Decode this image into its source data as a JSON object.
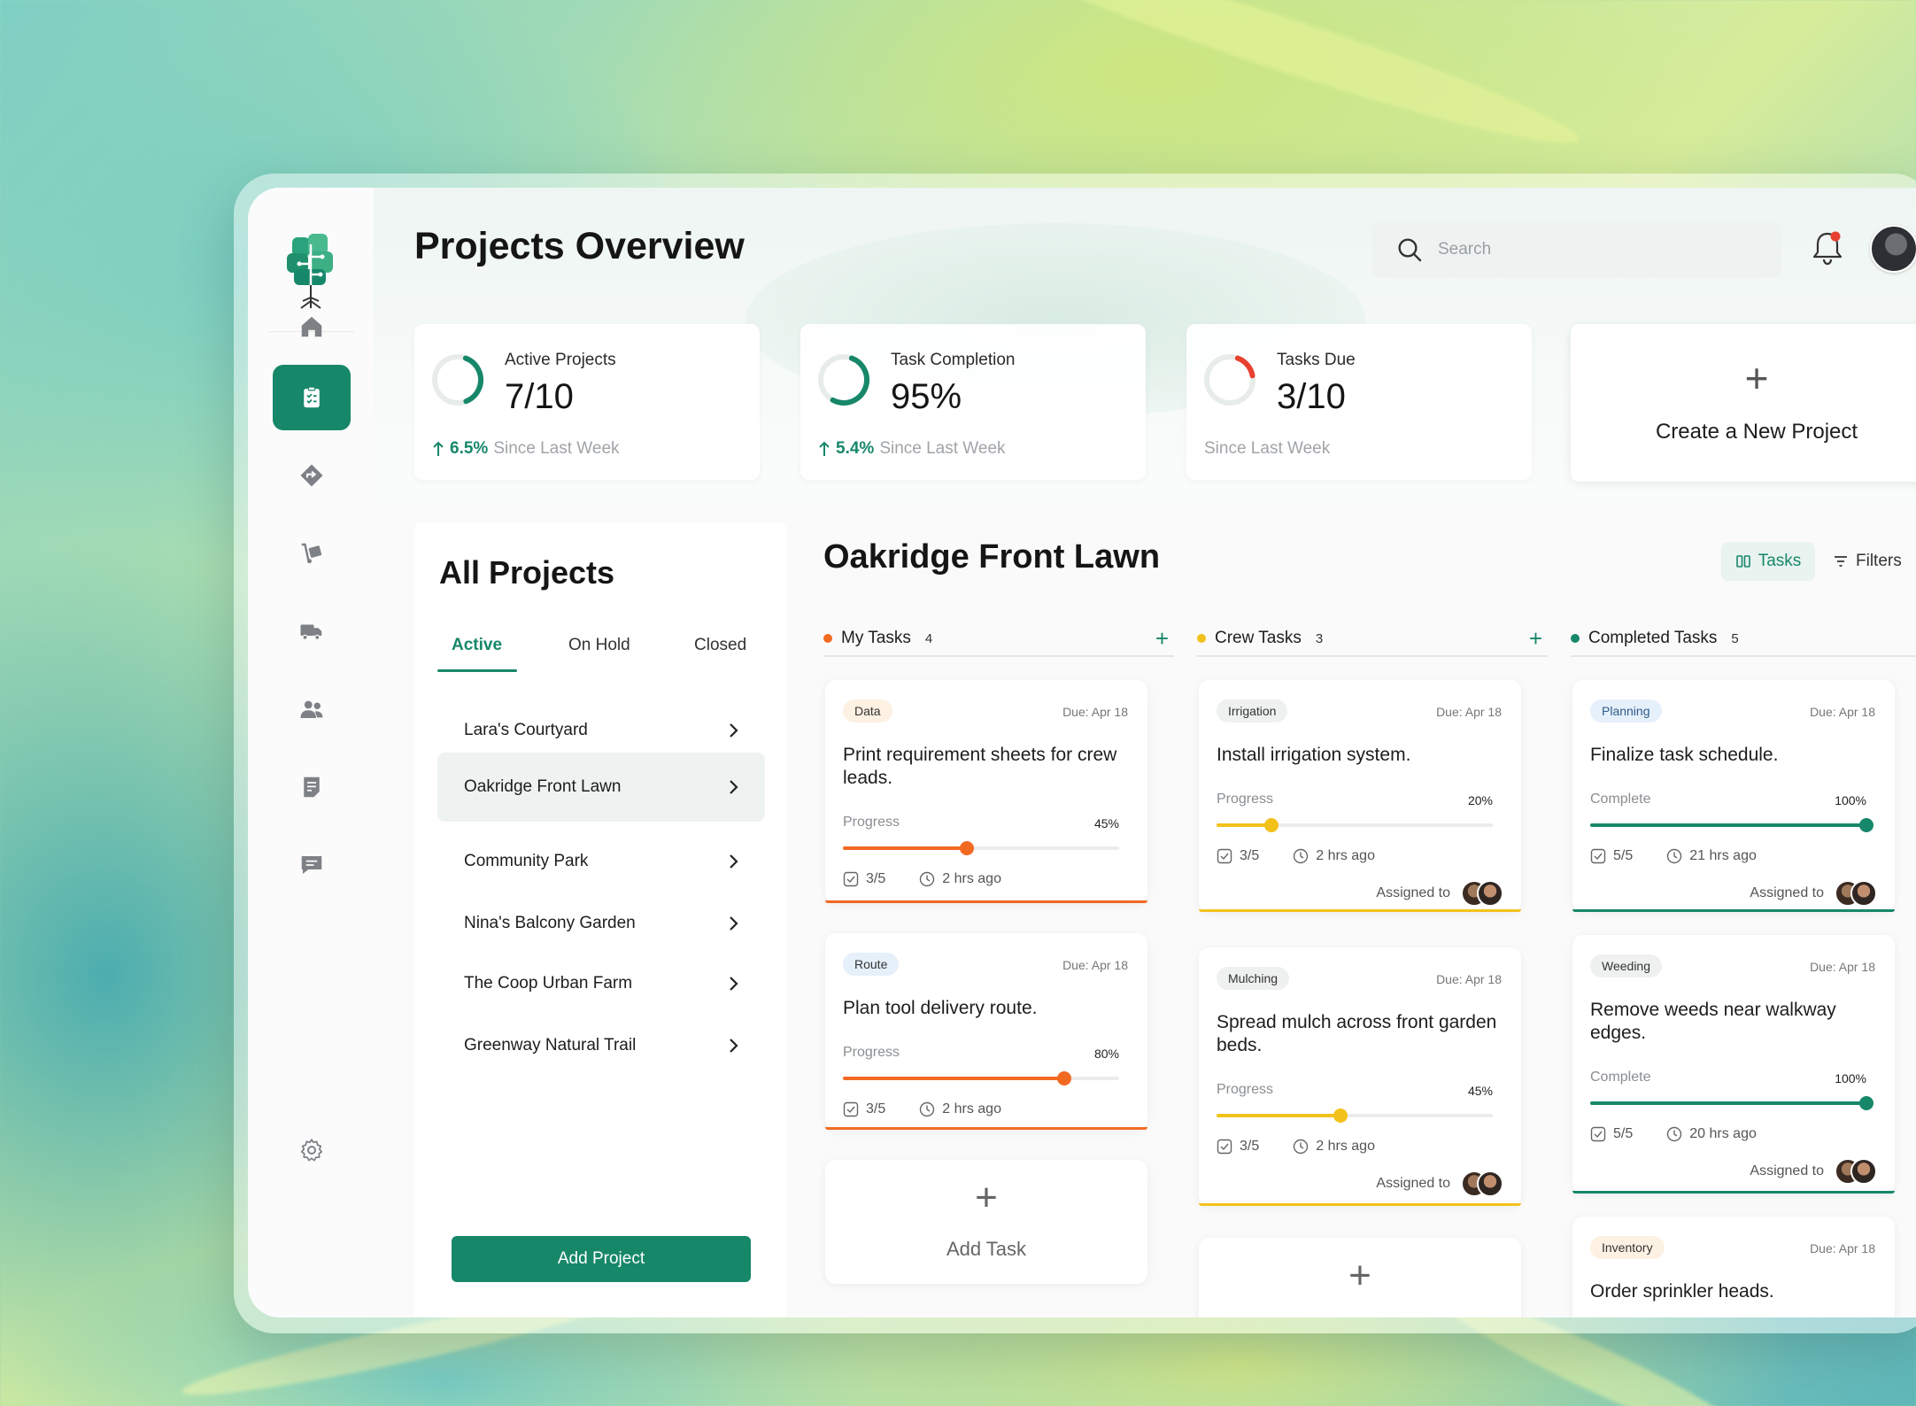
{
  "header": {
    "title": "Projects Overview",
    "search_placeholder": "Search"
  },
  "stats": [
    {
      "label": "Active Projects",
      "value": "7/10",
      "change": "6.5%",
      "since": "Since Last Week",
      "ring_fraction": 0.7,
      "ring_color": "#17876a"
    },
    {
      "label": "Task Completion",
      "value": "95%",
      "change": "5.4%",
      "since": "Since Last Week",
      "ring_fraction": 0.95,
      "ring_color": "#17876a"
    },
    {
      "label": "Tasks Due",
      "value": "3/10",
      "change": "",
      "since": "Since Last Week",
      "ring_fraction": 0.3,
      "ring_color": "#e8412f"
    }
  ],
  "create_project": {
    "plus": "+",
    "label": "Create a New Project"
  },
  "projects": {
    "title": "All Projects",
    "tabs": [
      "Active",
      "On Hold",
      "Closed"
    ],
    "items": [
      "Lara's Courtyard",
      "Oakridge Front Lawn",
      "Community Park",
      "Nina's Balcony Garden",
      "The Coop Urban Farm",
      "Greenway Natural Trail"
    ],
    "selected_index": 1,
    "add_label": "Add Project"
  },
  "board": {
    "title": "Oakridge Front Lawn",
    "view_label": "Tasks",
    "filter_label": "Filters",
    "columns": [
      {
        "name": "My Tasks",
        "count": "4",
        "color": "#f26a22",
        "cards": [
          {
            "tag": "Data",
            "tag_bg": "#fdf1e3",
            "tag_color": "#333333",
            "due": "Due: Apr 18",
            "title": "Print requirement sheets for crew leads.",
            "progress_label": "Progress",
            "progress": "45%",
            "progress_value": 0.45,
            "checklist": "3/5",
            "time": "2 hrs ago"
          },
          {
            "tag": "Route",
            "tag_bg": "#e6f0fb",
            "tag_color": "#333333",
            "due": "Due: Apr 18",
            "title": "Plan tool delivery route.",
            "progress_label": "Progress",
            "progress": "80%",
            "progress_value": 0.8,
            "checklist": "3/5",
            "time": "2 hrs ago"
          }
        ],
        "add_label": "Add Task"
      },
      {
        "name": "Crew Tasks",
        "count": "3",
        "color": "#f2c21b",
        "cards": [
          {
            "tag": "Irrigation",
            "tag_bg": "#eef1ef",
            "tag_color": "#333333",
            "due": "Due: Apr 18",
            "title": "Install irrigation system.",
            "progress_label": "Progress",
            "progress": "20%",
            "progress_value": 0.2,
            "checklist": "3/5",
            "time": "2 hrs ago",
            "assigned": "Assigned to"
          },
          {
            "tag": "Mulching",
            "tag_bg": "#eef1ef",
            "tag_color": "#333333",
            "due": "Due: Apr 18",
            "title": "Spread mulch across front garden beds.",
            "progress_label": "Progress",
            "progress": "45%",
            "progress_value": 0.45,
            "checklist": "3/5",
            "time": "2 hrs ago",
            "assigned": "Assigned to"
          }
        ]
      },
      {
        "name": "Completed Tasks",
        "count": "5",
        "color": "#17876a",
        "cards": [
          {
            "tag": "Planning",
            "tag_bg": "#e6f0fb",
            "tag_color": "#2d5b8a",
            "due": "Due: Apr 18",
            "title": "Finalize task schedule.",
            "progress_label": "Complete",
            "progress": "100%",
            "progress_value": 1.0,
            "checklist": "5/5",
            "time": "21 hrs ago",
            "assigned": "Assigned to"
          },
          {
            "tag": "Weeding",
            "tag_bg": "#eef1ef",
            "tag_color": "#333333",
            "due": "Due: Apr 18",
            "title": "Remove weeds near walkway edges.",
            "progress_label": "Complete",
            "progress": "100%",
            "progress_value": 1.0,
            "checklist": "5/5",
            "time": "20 hrs ago",
            "assigned": "Assigned to"
          },
          {
            "tag": "Inventory",
            "tag_bg": "#fdf1e3",
            "tag_color": "#333333",
            "due": "Due: Apr 18",
            "title": "Order sprinkler heads."
          }
        ]
      }
    ]
  },
  "colors": {
    "accent": "#17876a",
    "orange": "#f26a22",
    "yellow": "#f2c21b",
    "red": "#e8412f"
  }
}
